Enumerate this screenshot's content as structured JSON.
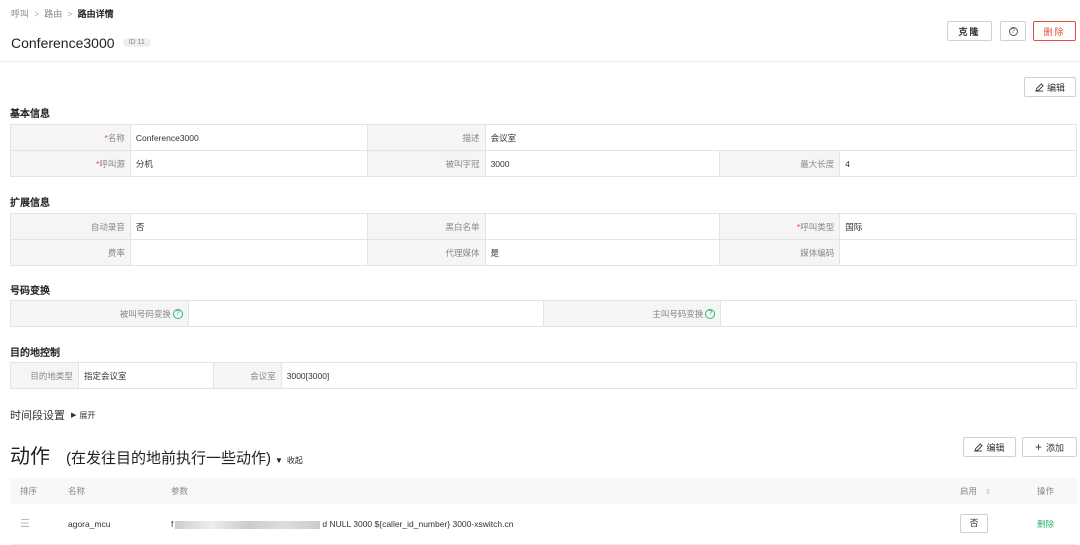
{
  "breadcrumb": {
    "items": [
      "呼叫",
      "路由"
    ],
    "current": "路由详情",
    "separator": ">"
  },
  "header": {
    "title": "Conference3000",
    "id_badge": "ID 11"
  },
  "toolbar": {
    "clone_label": "克隆",
    "help_label": "?",
    "delete_label": "删除"
  },
  "edit_label": "编辑",
  "edit_icon": "pencil-icon",
  "basic": {
    "title": "基本信息",
    "name_label": "名称",
    "name_value": "Conference3000",
    "desc_label": "描述",
    "desc_value": "会议室",
    "source_label": "呼叫源",
    "source_value": "分机",
    "prefix_label": "被叫字冠",
    "prefix_value": "3000",
    "maxlen_label": "最大长度",
    "maxlen_value": "4"
  },
  "extended": {
    "title": "扩展信息",
    "record_label": "自动录音",
    "record_value": "否",
    "blacklist_label": "黑白名单",
    "blacklist_value": "",
    "calltype_label": "呼叫类型",
    "calltype_value": "国际",
    "rate_label": "费率",
    "rate_value": "",
    "proxy_label": "代理媒体",
    "proxy_value": "是",
    "codec_label": "媒体编码",
    "codec_value": ""
  },
  "number_transform": {
    "title": "号码变换",
    "callee_label": "被叫号码变换",
    "callee_value": "",
    "caller_label": "主叫号码变换",
    "caller_value": ""
  },
  "destination": {
    "title": "目的地控制",
    "type_label": "目的地类型",
    "type_value": "指定会议室",
    "room_label": "会议室",
    "room_value": "3000[3000]"
  },
  "time_section": {
    "label": "时间段设置",
    "expand_label": "展开"
  },
  "actions": {
    "title": "动作",
    "subtitle": "(在发往目的地前执行一些动作)",
    "collapse_label": "收起",
    "edit_label": "编辑",
    "add_label": "添加",
    "columns": {
      "order": "排序",
      "name": "名称",
      "params": "参数",
      "enabled": "启用",
      "ops": "操作"
    },
    "rows": [
      {
        "name": "agora_mcu",
        "param_start": "f",
        "param_end": "d NULL 3000 ${caller_id_number} 3000-xswitch.cn",
        "enabled": "否",
        "op": "删除"
      }
    ]
  },
  "colors": {
    "accent": "#2bb673",
    "danger": "#e74c3c",
    "required": "#e74c3c"
  }
}
